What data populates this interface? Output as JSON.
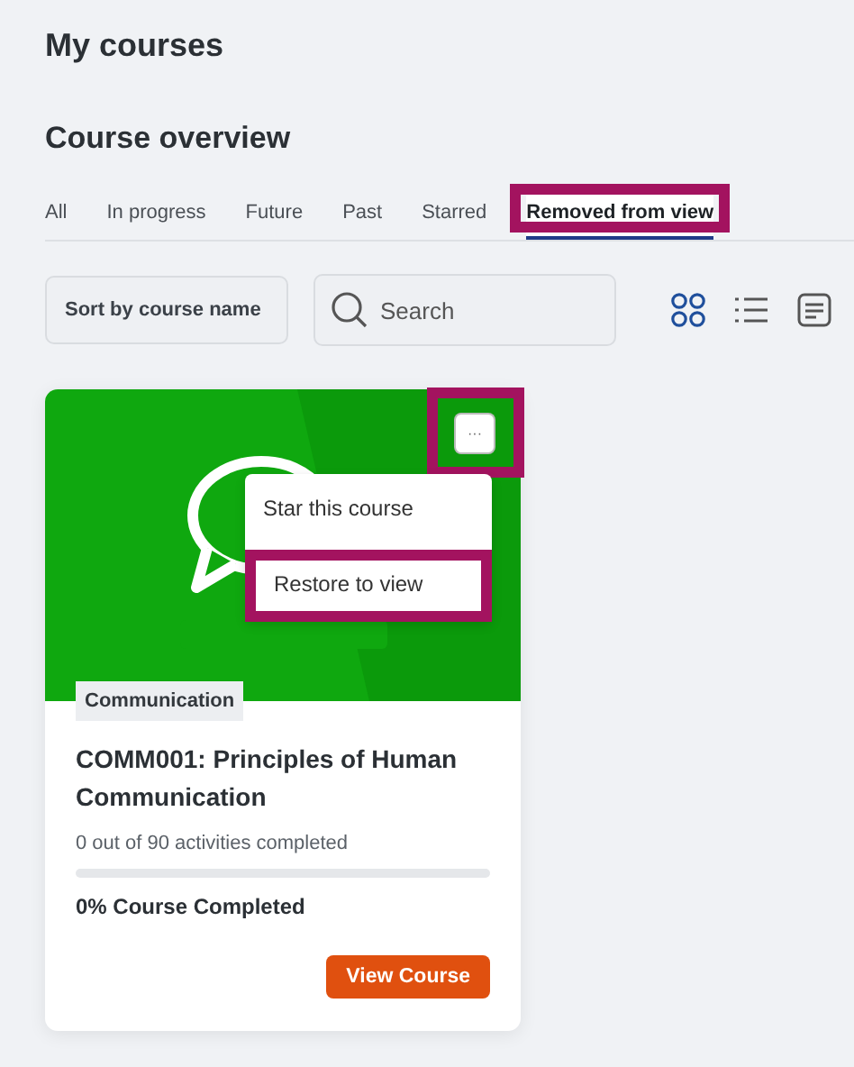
{
  "page_title": "My courses",
  "section_title": "Course overview",
  "tabs": [
    {
      "label": "All",
      "selected": false
    },
    {
      "label": "In progress",
      "selected": false
    },
    {
      "label": "Future",
      "selected": false
    },
    {
      "label": "Past",
      "selected": false
    },
    {
      "label": "Starred",
      "selected": false
    },
    {
      "label": "Removed from view",
      "selected": true,
      "highlighted": true
    }
  ],
  "sort_dropdown": {
    "label": "Sort by course name"
  },
  "search": {
    "placeholder": "Search"
  },
  "view_options": [
    {
      "kind": "grid",
      "selected": true
    },
    {
      "kind": "list",
      "selected": false
    },
    {
      "kind": "summary",
      "selected": false
    }
  ],
  "courses": [
    {
      "category": "Communication",
      "title": "COMM001: Principles of Human Communication",
      "activities": "0 out of 90 activities completed",
      "level": 0,
      "completion": "0% Course Completed",
      "button": "View Course",
      "menu": {
        "label": "···",
        "expanded": true,
        "highlighted": true,
        "items": [
          {
            "label": "Star this course",
            "highlighted": false
          },
          {
            "label": "Restore to view",
            "highlighted": true
          }
        ]
      }
    }
  ]
}
